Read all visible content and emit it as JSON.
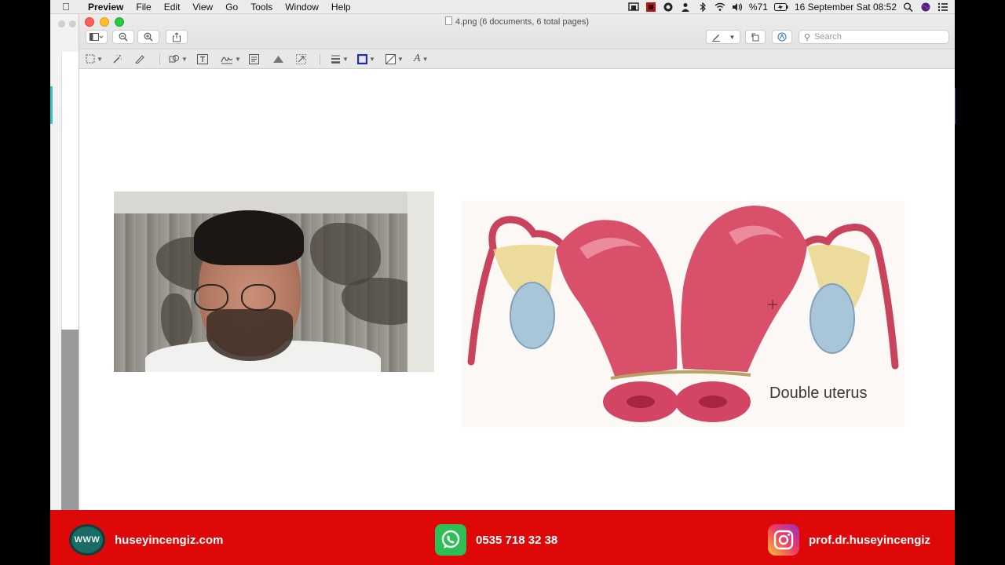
{
  "menubar": {
    "app": "Preview",
    "items": [
      "File",
      "Edit",
      "View",
      "Go",
      "Tools",
      "Window",
      "Help"
    ],
    "battery": "%71",
    "datetime": "16 September Sat  08:52"
  },
  "window": {
    "title": "4.png (6 documents, 6 total pages)",
    "search_placeholder": "Search"
  },
  "diagram": {
    "label": "Double uterus"
  },
  "footer": {
    "website": "huseyincengiz.com",
    "website_icon_text": "WWW",
    "phone": "0535 718 32 38",
    "instagram": "prof.dr.huseyincengiz"
  },
  "colors": {
    "banner": "#de0808",
    "whatsapp": "#2dbe55",
    "uterus": "#d9506a"
  }
}
